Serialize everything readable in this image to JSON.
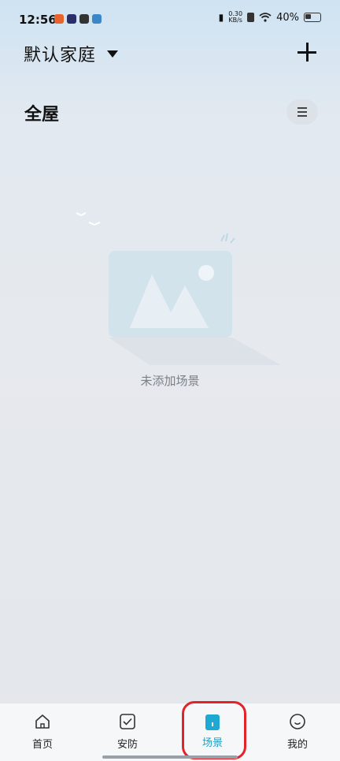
{
  "status_bar": {
    "time": "12:56",
    "net_speed_value": "0.30",
    "net_speed_unit": "KB/s",
    "battery": "40%"
  },
  "header": {
    "home_name": "默认家庭"
  },
  "room": {
    "title": "全屋"
  },
  "empty_state": {
    "message": "未添加场景"
  },
  "bottom_nav": {
    "tabs": [
      {
        "label": "首页",
        "icon": "home-icon",
        "active": false
      },
      {
        "label": "安防",
        "icon": "security-check-icon",
        "active": false
      },
      {
        "label": "场景",
        "icon": "scene-icon",
        "active": true
      },
      {
        "label": "我的",
        "icon": "profile-icon",
        "active": false
      }
    ]
  },
  "colors": {
    "accent": "#1fa9d2",
    "highlight_box": "#e3222a"
  }
}
